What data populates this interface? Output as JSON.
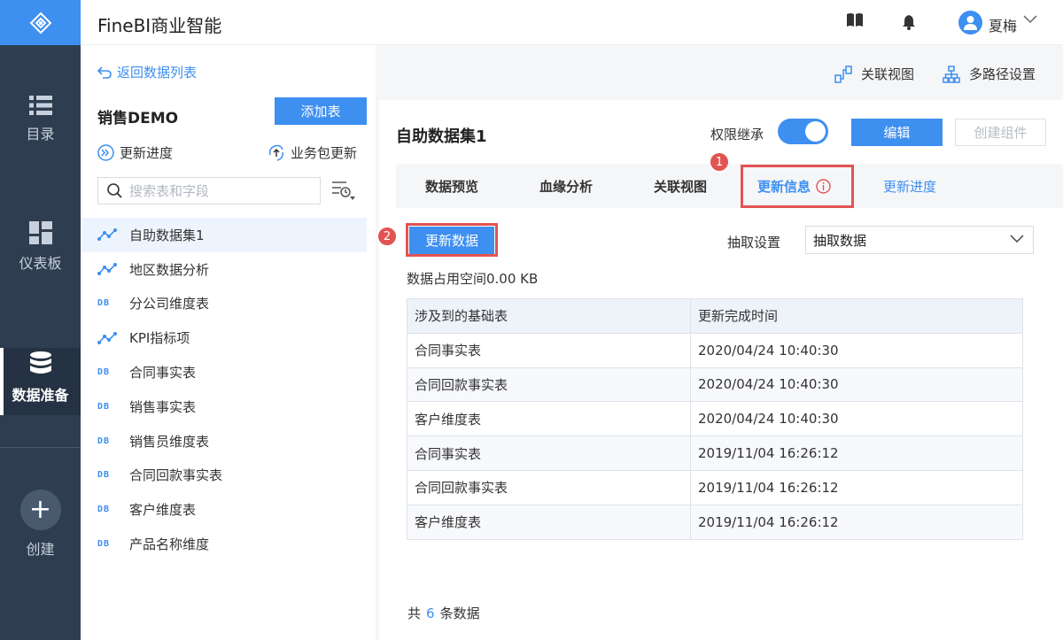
{
  "app": {
    "title": "FineBI商业智能"
  },
  "nav": {
    "items": [
      {
        "label": "目录",
        "icon": "list-icon"
      },
      {
        "label": "仪表板",
        "icon": "dashboard-icon"
      },
      {
        "label": "数据准备",
        "icon": "database-icon",
        "active": true
      },
      {
        "label": "创建",
        "icon": "plus-icon"
      }
    ]
  },
  "user": {
    "name": "夏梅"
  },
  "sidebar": {
    "back_label": "返回数据列表",
    "package_name": "销售DEMO",
    "add_table_label": "添加表",
    "update_progress_label": "更新进度",
    "package_update_label": "业务包更新",
    "search_placeholder": "搜索表和字段",
    "tables": [
      {
        "name": "自助数据集1",
        "type": "self-service",
        "active": true
      },
      {
        "name": "地区数据分析",
        "type": "self-service"
      },
      {
        "name": "分公司维度表",
        "type": "db"
      },
      {
        "name": "KPI指标项",
        "type": "self-service"
      },
      {
        "name": "合同事实表",
        "type": "db"
      },
      {
        "name": "销售事实表",
        "type": "db"
      },
      {
        "name": "销售员维度表",
        "type": "db"
      },
      {
        "name": "合同回款事实表",
        "type": "db"
      },
      {
        "name": "客户维度表",
        "type": "db"
      },
      {
        "name": "产品名称维度",
        "type": "db"
      }
    ],
    "db_tag": "DB"
  },
  "toolbar": {
    "relation_view_label": "关联视图",
    "multipath_label": "多路径设置"
  },
  "dataset": {
    "title": "自助数据集1",
    "permission_label": "权限继承",
    "permission_on": true,
    "edit_label": "编辑",
    "create_component_label": "创建组件",
    "tabs": [
      {
        "label": "数据预览"
      },
      {
        "label": "血缘分析"
      },
      {
        "label": "关联视图"
      },
      {
        "label": "更新信息",
        "active": true
      },
      {
        "label": "更新进度"
      }
    ],
    "update_button_label": "更新数据",
    "extract_label": "抽取设置",
    "extract_value": "抽取数据",
    "space_text": "数据占用空间0.00 KB",
    "table_headers": [
      "涉及到的基础表",
      "更新完成时间"
    ],
    "rows": [
      [
        "合同事实表",
        "2020/04/24 10:40:30"
      ],
      [
        "合同回款事实表",
        "2020/04/24 10:40:30"
      ],
      [
        "客户维度表",
        "2020/04/24 10:40:30"
      ],
      [
        "合同事实表",
        "2019/11/04 16:26:12"
      ],
      [
        "合同回款事实表",
        "2019/11/04 16:26:12"
      ],
      [
        "客户维度表",
        "2019/11/04 16:26:12"
      ]
    ],
    "total_prefix": "共",
    "total_count": "6",
    "total_suffix": "条数据"
  },
  "annotations": {
    "badge1": "1",
    "badge2": "2"
  },
  "colors": {
    "accent": "#3d8ff0",
    "nav_bg": "#2f3d50",
    "highlight": "#e15453"
  }
}
